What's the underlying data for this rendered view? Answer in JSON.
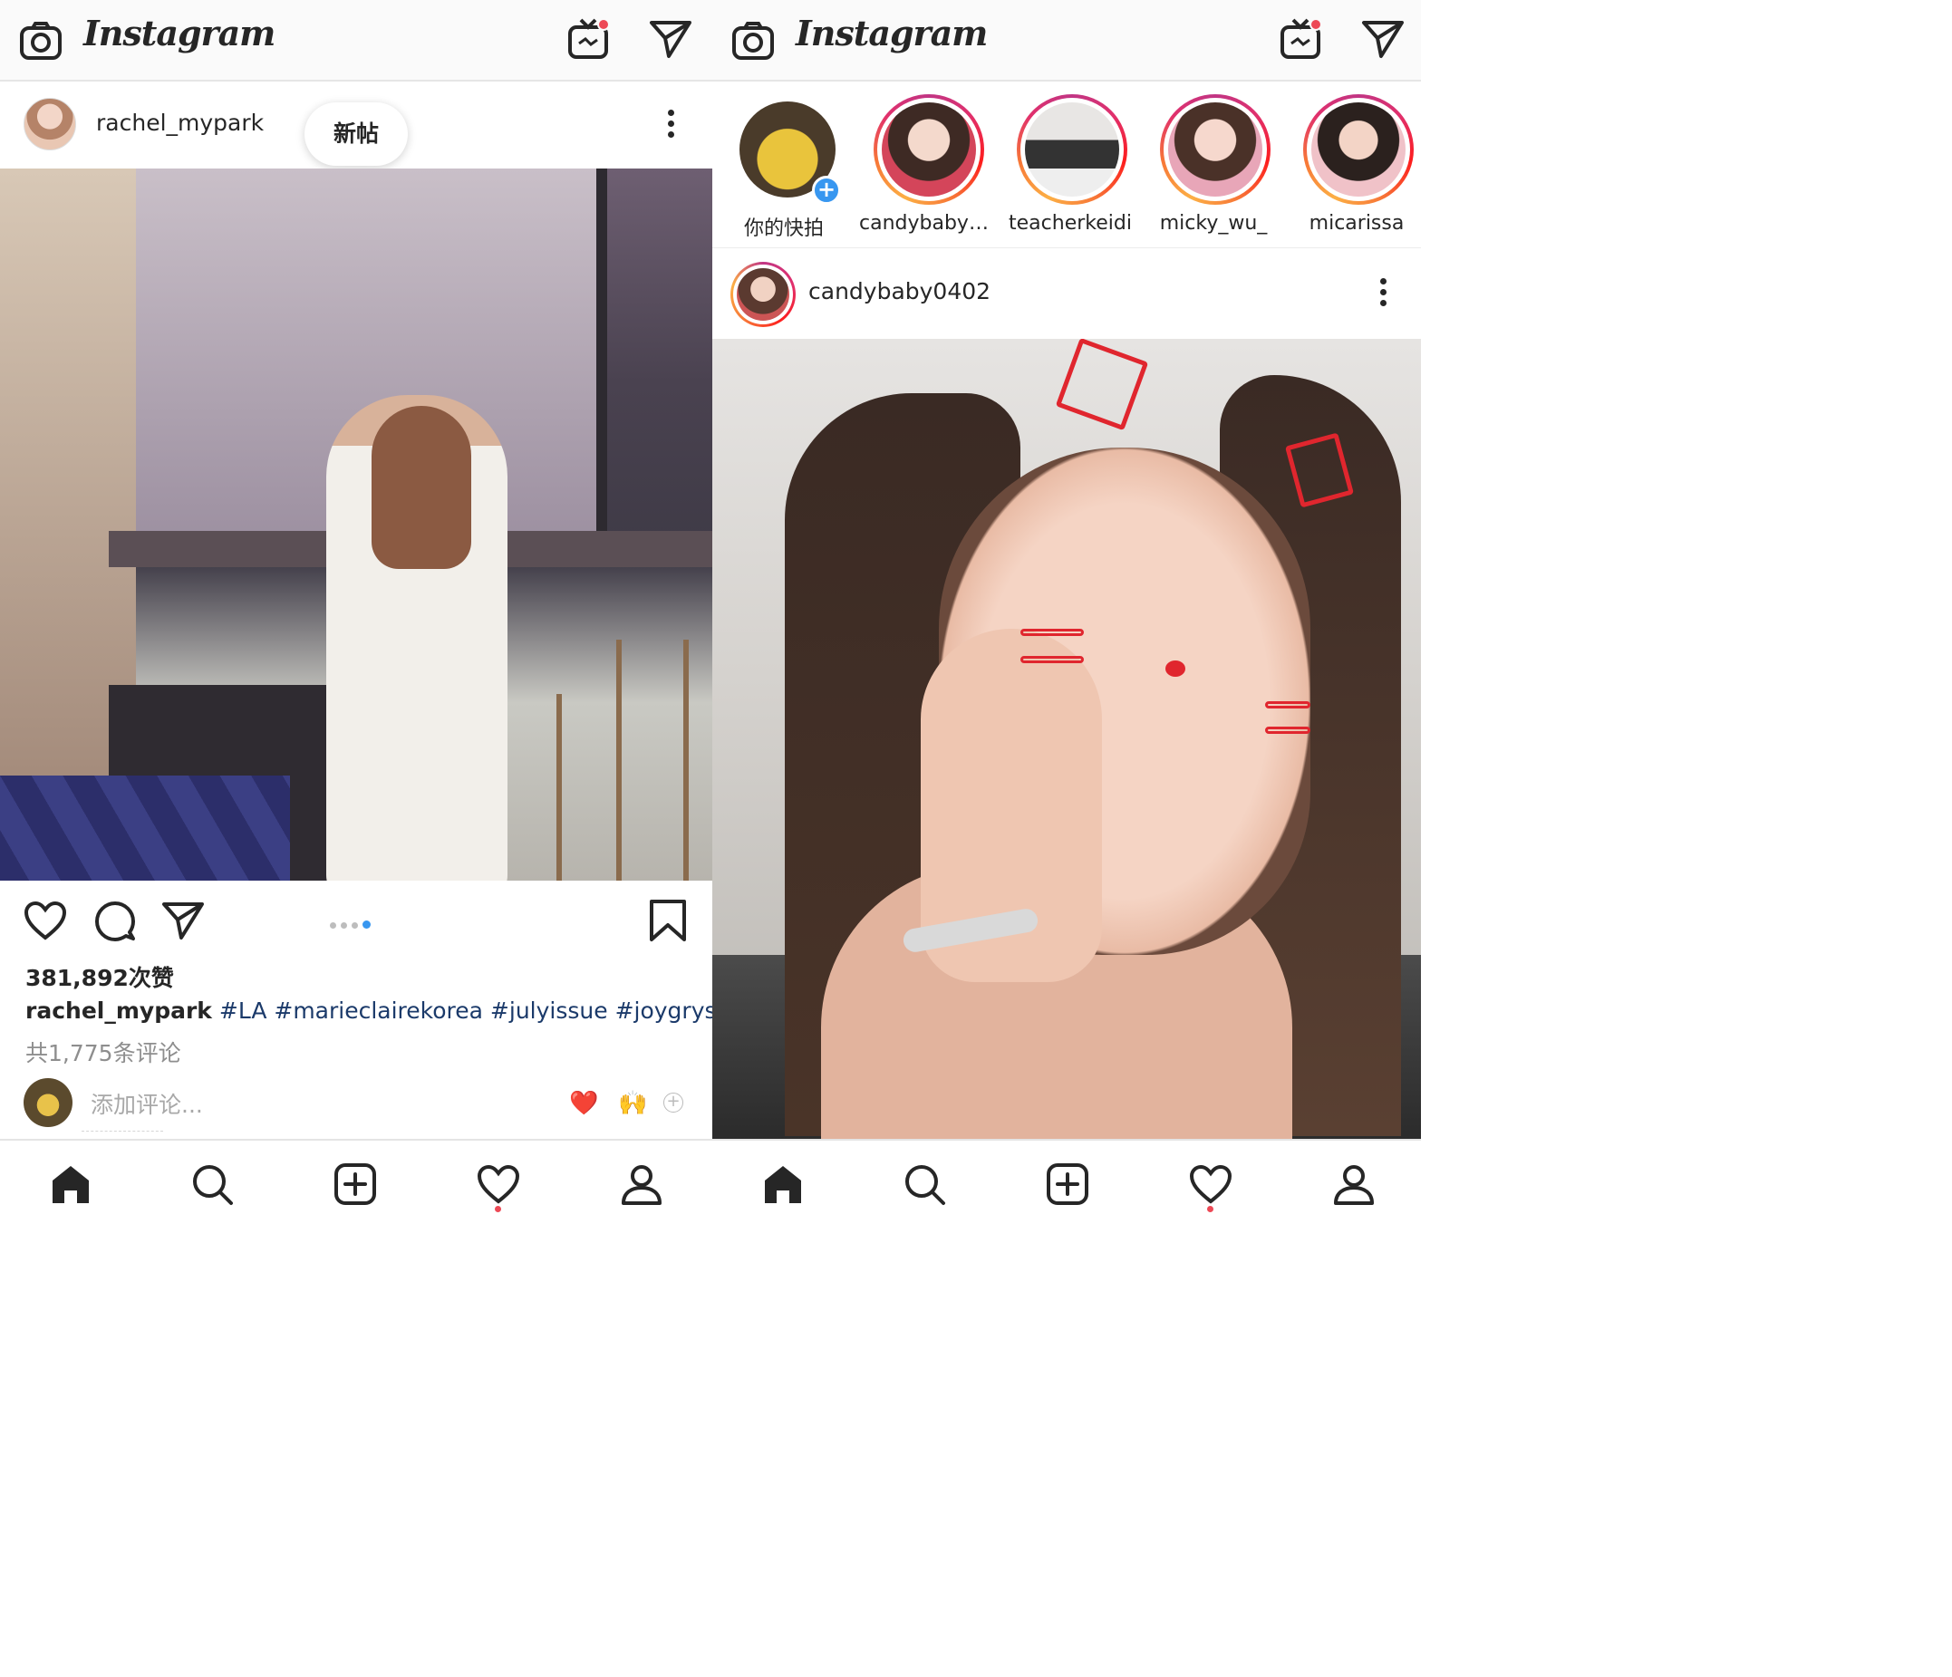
{
  "app": {
    "name": "Instagram"
  },
  "left_feed": {
    "post": {
      "username": "rachel_mypark",
      "new_posts_pill": "新帖",
      "carousel": {
        "count": 4,
        "active_index": 3
      },
      "likes": "381,892次赞",
      "caption": {
        "username": "rachel_mypark",
        "hashtags": "#LA #marieclairekorea #julyissue #joygryson"
      },
      "view_comments": "共1,775条评论",
      "add_comment_placeholder": "添加评论...",
      "quick_emojis": [
        "❤️",
        "🙌"
      ]
    }
  },
  "right_feed": {
    "stories": [
      {
        "label": "你的快拍",
        "is_mine": true
      },
      {
        "label": "candybaby0..."
      },
      {
        "label": "teacherkeidi"
      },
      {
        "label": "micky_wu_"
      },
      {
        "label": "micarissa"
      }
    ],
    "post": {
      "username": "candybaby0402"
    }
  },
  "nav": {
    "items": [
      "home-icon",
      "search-icon",
      "new-post-icon",
      "activity-icon",
      "profile-icon"
    ],
    "active": "home-icon",
    "activity_has_notification": true
  },
  "colors": {
    "accent_blue": "#3897f0",
    "notification_red": "#ed4956",
    "heart_red": "#e0262e"
  }
}
